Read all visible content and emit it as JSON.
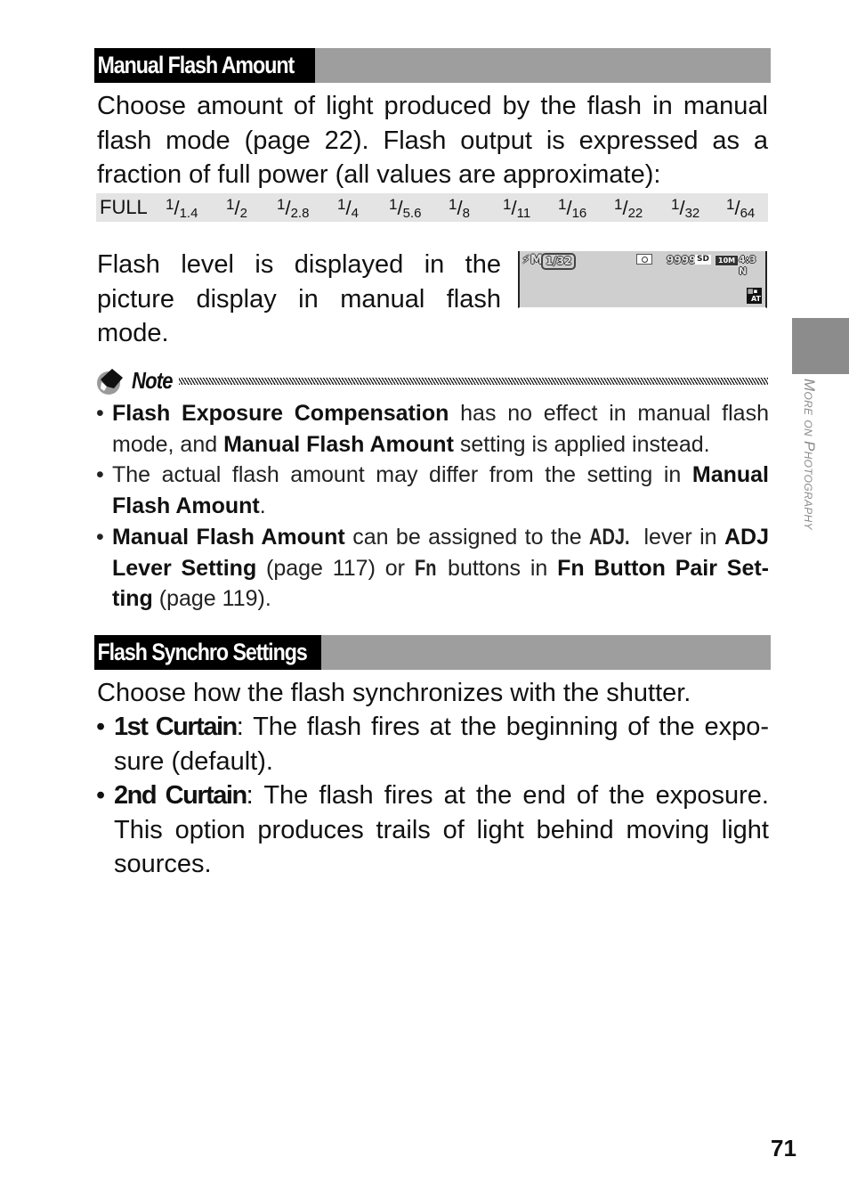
{
  "sections": {
    "manual_flash": {
      "title": "Manual Flash Amount",
      "intro": "Choose amount of light produced by the flash in manual flash mode (page 22). Flash output is expressed as a fraction of full power (all values are approximate):",
      "values": [
        {
          "label": "FULL"
        },
        {
          "num": "1",
          "den": "1.4"
        },
        {
          "num": "1",
          "den": "2"
        },
        {
          "num": "1",
          "den": "2.8"
        },
        {
          "num": "1",
          "den": "4"
        },
        {
          "num": "1",
          "den": "5.6"
        },
        {
          "num": "1",
          "den": "8"
        },
        {
          "num": "1",
          "den": "11"
        },
        {
          "num": "1",
          "den": "16"
        },
        {
          "num": "1",
          "den": "22"
        },
        {
          "num": "1",
          "den": "32"
        },
        {
          "num": "1",
          "den": "64"
        }
      ],
      "display_text": "Flash level is displayed in the picture display in manual flash mode.",
      "lcd": {
        "flash_mode_icon": "flash-manual-icon",
        "flash_mode_glyph": "⚡M",
        "flash_level": "1/32",
        "shooting_mode_icon": "camera-icon",
        "shots_remaining": "9999",
        "media": "SD",
        "image_size": "10M",
        "aspect_quality": "4:3 N",
        "white_balance_icon": "auto-white-balance-icon",
        "white_balance_label": "AT"
      }
    },
    "note": {
      "label": "Note",
      "items": [
        {
          "parts": [
            {
              "b": "Flash Exposure Compensation"
            },
            {
              "t": " has no effect in manual flash mode, and "
            },
            {
              "b": "Manual Flash Amount"
            },
            {
              "t": " setting is applied instead."
            }
          ]
        },
        {
          "parts": [
            {
              "t": "The actual flash amount may differ from the setting in "
            },
            {
              "b": "Manual Flash Amount"
            },
            {
              "t": "."
            }
          ]
        },
        {
          "parts": [
            {
              "b": "Manual Flash Amount"
            },
            {
              "t": " can be assigned to the "
            },
            {
              "c": "ADJ."
            },
            {
              "t": " lever in "
            },
            {
              "b": "ADJ Lever Setting"
            },
            {
              "t": " (page 117) or "
            },
            {
              "c": "Fn"
            },
            {
              "t": " buttons in "
            },
            {
              "b": "Fn Button Pair Set-ting"
            },
            {
              "t": " (page 119)."
            }
          ]
        }
      ]
    },
    "flash_sync": {
      "title": "Flash Synchro Settings",
      "intro": "Choose how the flash synchronizes with the shutter.",
      "options": [
        {
          "term": "1st Curtain",
          "desc": ": The flash fires at the beginning of the expo-sure (default)."
        },
        {
          "term": "2nd Curtain",
          "desc": ": The flash fires at the end of the exposure. This option produces trails of light behind moving light sources."
        }
      ]
    }
  },
  "side_tab": {
    "label": "More on Photography"
  },
  "page_number": "71",
  "bullet": "•"
}
